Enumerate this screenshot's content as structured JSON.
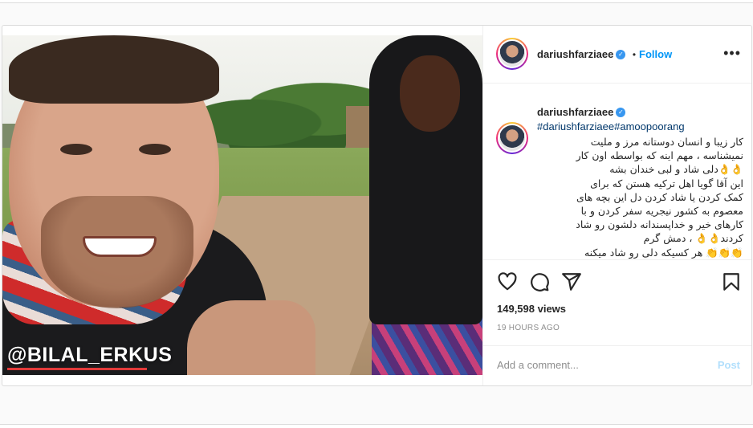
{
  "post": {
    "username": "dariushfarziaee",
    "verified_icon": "verified-badge-icon",
    "separator": "•",
    "follow_label": "Follow",
    "more_icon": "more-options-icon",
    "more_label": "•••"
  },
  "media": {
    "watermark": "@BILAL_ERKUS"
  },
  "caption": {
    "username": "dariushfarziaee",
    "hashtags": "#dariushfarziaee#amoopoorang",
    "lines": [
      "کار زیبا و انسان دوستانه مرز و ملیت",
      "نمیشناسه ، مهم اینه که بواسطه اون کار",
      "👌👌دلی شاد و لبی خندان بشه",
      "این آقا گویا اهل ترکیه هستن که برای",
      "کمک کردن یا شاد کردن دل این بچه های",
      "معصوم به کشور نیجریه سفر کردن و با",
      "کارهای خیر و خداپسندانه دلشون رو شاد",
      "کردند👌👌 ، دمش گرم",
      "👏👏👏 هر کسیکه دلی رو شاد میکنه"
    ]
  },
  "actions": {
    "like_icon": "heart-icon",
    "comment_icon": "comment-icon",
    "share_icon": "share-icon",
    "save_icon": "bookmark-icon"
  },
  "stats": {
    "views": "149,598 views",
    "time": "19 HOURS AGO"
  },
  "comment": {
    "placeholder": "Add a comment...",
    "post_label": "Post"
  },
  "colors": {
    "link": "#0095f6",
    "hashtag": "#00376b",
    "post_disabled": "#b2dffc",
    "border": "#dbdbdb"
  }
}
